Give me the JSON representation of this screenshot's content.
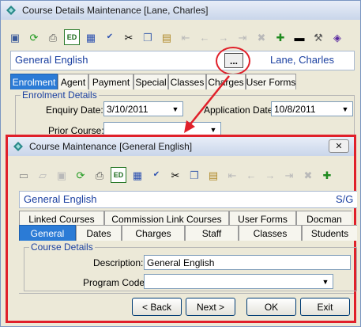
{
  "main_window": {
    "title": "Course Details Maintenance  [Lane, Charles]",
    "course_name": "General English",
    "ellipsis_label": "...",
    "student_name": "Lane, Charles",
    "tabs": [
      {
        "label": "Enrolment"
      },
      {
        "label": "Agent"
      },
      {
        "label": "Payment"
      },
      {
        "label": "Special"
      },
      {
        "label": "Classes"
      },
      {
        "label": "Charges"
      },
      {
        "label": "User Forms"
      }
    ],
    "section": "Enrolment Details",
    "enquiry_date_label": "Enquiry Date:",
    "enquiry_date_value": "3/10/2011",
    "application_date_label": "Application Date:",
    "application_date_value": "10/8/2011",
    "prior_course_label": "Prior Course:",
    "prior_course_value": ""
  },
  "popup": {
    "title": "Course Maintenance  [General English]",
    "close_label": "✕",
    "course_name": "General English",
    "right_code": "S/G",
    "tabs_row1": [
      {
        "label": "Linked Courses"
      },
      {
        "label": "Commission Link Courses"
      },
      {
        "label": "User Forms"
      },
      {
        "label": "Docman"
      }
    ],
    "tabs_row2": [
      {
        "label": "General"
      },
      {
        "label": "Dates"
      },
      {
        "label": "Charges"
      },
      {
        "label": "Staff"
      },
      {
        "label": "Classes"
      },
      {
        "label": "Students"
      }
    ],
    "section": "Course Details",
    "description_label": "Description:",
    "description_value": "General English",
    "program_code_label": "Program Code:",
    "program_code_value": "",
    "buttons": {
      "back": "< Back",
      "next": "Next >",
      "ok": "OK",
      "exit": "Exit"
    }
  },
  "colors": {
    "accent": "#2b7bd6",
    "link_blue": "#1a3fa0",
    "highlight_red": "#e0202a"
  }
}
